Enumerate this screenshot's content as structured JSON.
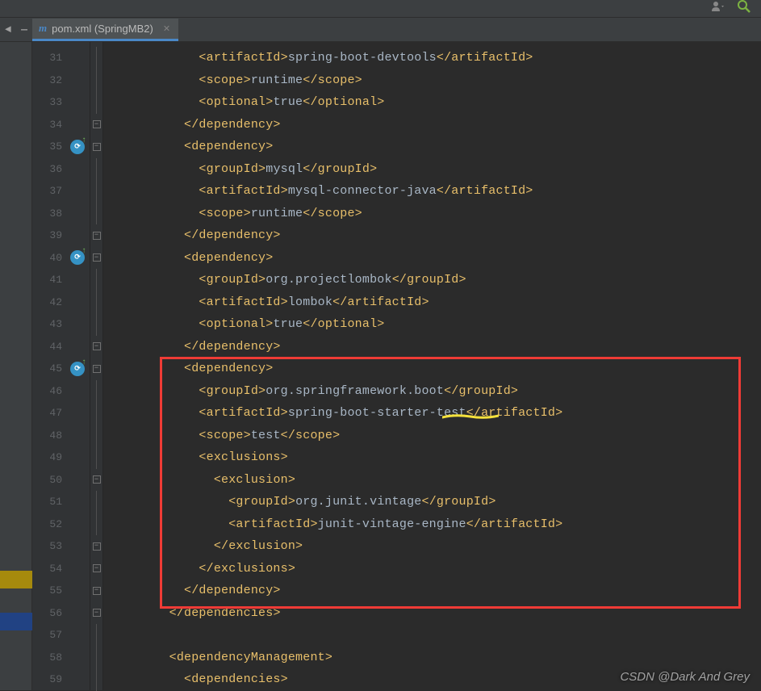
{
  "tab": {
    "filename": "pom.xml (SpringMB2)"
  },
  "gutter": {
    "start": 31,
    "end": 59,
    "icons_at": [
      35,
      40,
      45
    ]
  },
  "folds": {
    "toggles": [
      35,
      40,
      45,
      50
    ],
    "toggles_up": [
      34,
      39,
      44,
      53,
      54,
      55,
      56
    ],
    "lines": [
      31,
      32,
      33,
      36,
      37,
      38,
      41,
      42,
      43,
      46,
      47,
      48,
      49,
      51,
      52,
      57,
      58,
      59
    ]
  },
  "code": [
    {
      "n": 31,
      "indent": 12,
      "tokens": [
        [
          "tag",
          "<artifactId>"
        ],
        [
          "text",
          "spring-boot-devtools"
        ],
        [
          "tag",
          "</artifactId>"
        ]
      ]
    },
    {
      "n": 32,
      "indent": 12,
      "tokens": [
        [
          "tag",
          "<scope>"
        ],
        [
          "text",
          "runtime"
        ],
        [
          "tag",
          "</scope>"
        ]
      ]
    },
    {
      "n": 33,
      "indent": 12,
      "tokens": [
        [
          "tag",
          "<optional>"
        ],
        [
          "text",
          "true"
        ],
        [
          "tag",
          "</optional>"
        ]
      ]
    },
    {
      "n": 34,
      "indent": 10,
      "tokens": [
        [
          "tag",
          "</dependency>"
        ]
      ]
    },
    {
      "n": 35,
      "indent": 10,
      "tokens": [
        [
          "tag",
          "<dependency>"
        ]
      ]
    },
    {
      "n": 36,
      "indent": 12,
      "tokens": [
        [
          "tag",
          "<groupId>"
        ],
        [
          "text",
          "mysql"
        ],
        [
          "tag",
          "</groupId>"
        ]
      ]
    },
    {
      "n": 37,
      "indent": 12,
      "tokens": [
        [
          "tag",
          "<artifactId>"
        ],
        [
          "text",
          "mysql-connector-java"
        ],
        [
          "tag",
          "</artifactId>"
        ]
      ]
    },
    {
      "n": 38,
      "indent": 12,
      "tokens": [
        [
          "tag",
          "<scope>"
        ],
        [
          "text",
          "runtime"
        ],
        [
          "tag",
          "</scope>"
        ]
      ]
    },
    {
      "n": 39,
      "indent": 10,
      "tokens": [
        [
          "tag",
          "</dependency>"
        ]
      ]
    },
    {
      "n": 40,
      "indent": 10,
      "tokens": [
        [
          "tag",
          "<dependency>"
        ]
      ]
    },
    {
      "n": 41,
      "indent": 12,
      "tokens": [
        [
          "tag",
          "<groupId>"
        ],
        [
          "text",
          "org.projectlombok"
        ],
        [
          "tag",
          "</groupId>"
        ]
      ]
    },
    {
      "n": 42,
      "indent": 12,
      "tokens": [
        [
          "tag",
          "<artifactId>"
        ],
        [
          "text",
          "lombok"
        ],
        [
          "tag",
          "</artifactId>"
        ]
      ]
    },
    {
      "n": 43,
      "indent": 12,
      "tokens": [
        [
          "tag",
          "<optional>"
        ],
        [
          "text",
          "true"
        ],
        [
          "tag",
          "</optional>"
        ]
      ]
    },
    {
      "n": 44,
      "indent": 10,
      "tokens": [
        [
          "tag",
          "</dependency>"
        ]
      ]
    },
    {
      "n": 45,
      "indent": 10,
      "tokens": [
        [
          "tag",
          "<dependency>"
        ]
      ]
    },
    {
      "n": 46,
      "indent": 12,
      "tokens": [
        [
          "tag",
          "<groupId>"
        ],
        [
          "text",
          "org.springframework.boot"
        ],
        [
          "tag",
          "</groupId>"
        ]
      ]
    },
    {
      "n": 47,
      "indent": 12,
      "tokens": [
        [
          "tag",
          "<artifactId>"
        ],
        [
          "text",
          "spring-boot-starter-test"
        ],
        [
          "tag",
          "</artifactId>"
        ]
      ]
    },
    {
      "n": 48,
      "indent": 12,
      "tokens": [
        [
          "tag",
          "<scope>"
        ],
        [
          "text",
          "test"
        ],
        [
          "tag",
          "</scope>"
        ]
      ]
    },
    {
      "n": 49,
      "indent": 12,
      "tokens": [
        [
          "tag",
          "<exclusions>"
        ]
      ]
    },
    {
      "n": 50,
      "indent": 14,
      "tokens": [
        [
          "tag",
          "<exclusion>"
        ]
      ]
    },
    {
      "n": 51,
      "indent": 16,
      "tokens": [
        [
          "tag",
          "<groupId>"
        ],
        [
          "text",
          "org.junit.vintage"
        ],
        [
          "tag",
          "</groupId>"
        ]
      ]
    },
    {
      "n": 52,
      "indent": 16,
      "tokens": [
        [
          "tag",
          "<artifactId>"
        ],
        [
          "text",
          "junit-vintage-engine"
        ],
        [
          "tag",
          "</artifactId>"
        ]
      ]
    },
    {
      "n": 53,
      "indent": 14,
      "tokens": [
        [
          "tag",
          "</exclusion>"
        ]
      ]
    },
    {
      "n": 54,
      "indent": 12,
      "tokens": [
        [
          "tag",
          "</exclusions>"
        ]
      ]
    },
    {
      "n": 55,
      "indent": 10,
      "tokens": [
        [
          "tag",
          "</dependency>"
        ]
      ]
    },
    {
      "n": 56,
      "indent": 8,
      "tokens": [
        [
          "tag",
          "</dependencies>"
        ]
      ]
    },
    {
      "n": 57,
      "indent": 0,
      "tokens": []
    },
    {
      "n": 58,
      "indent": 8,
      "tokens": [
        [
          "tag",
          "<dependencyManagement>"
        ]
      ]
    },
    {
      "n": 59,
      "indent": 10,
      "tokens": [
        [
          "tag",
          "<dependencies>"
        ]
      ]
    }
  ],
  "watermark": "CSDN @Dark And Grey"
}
